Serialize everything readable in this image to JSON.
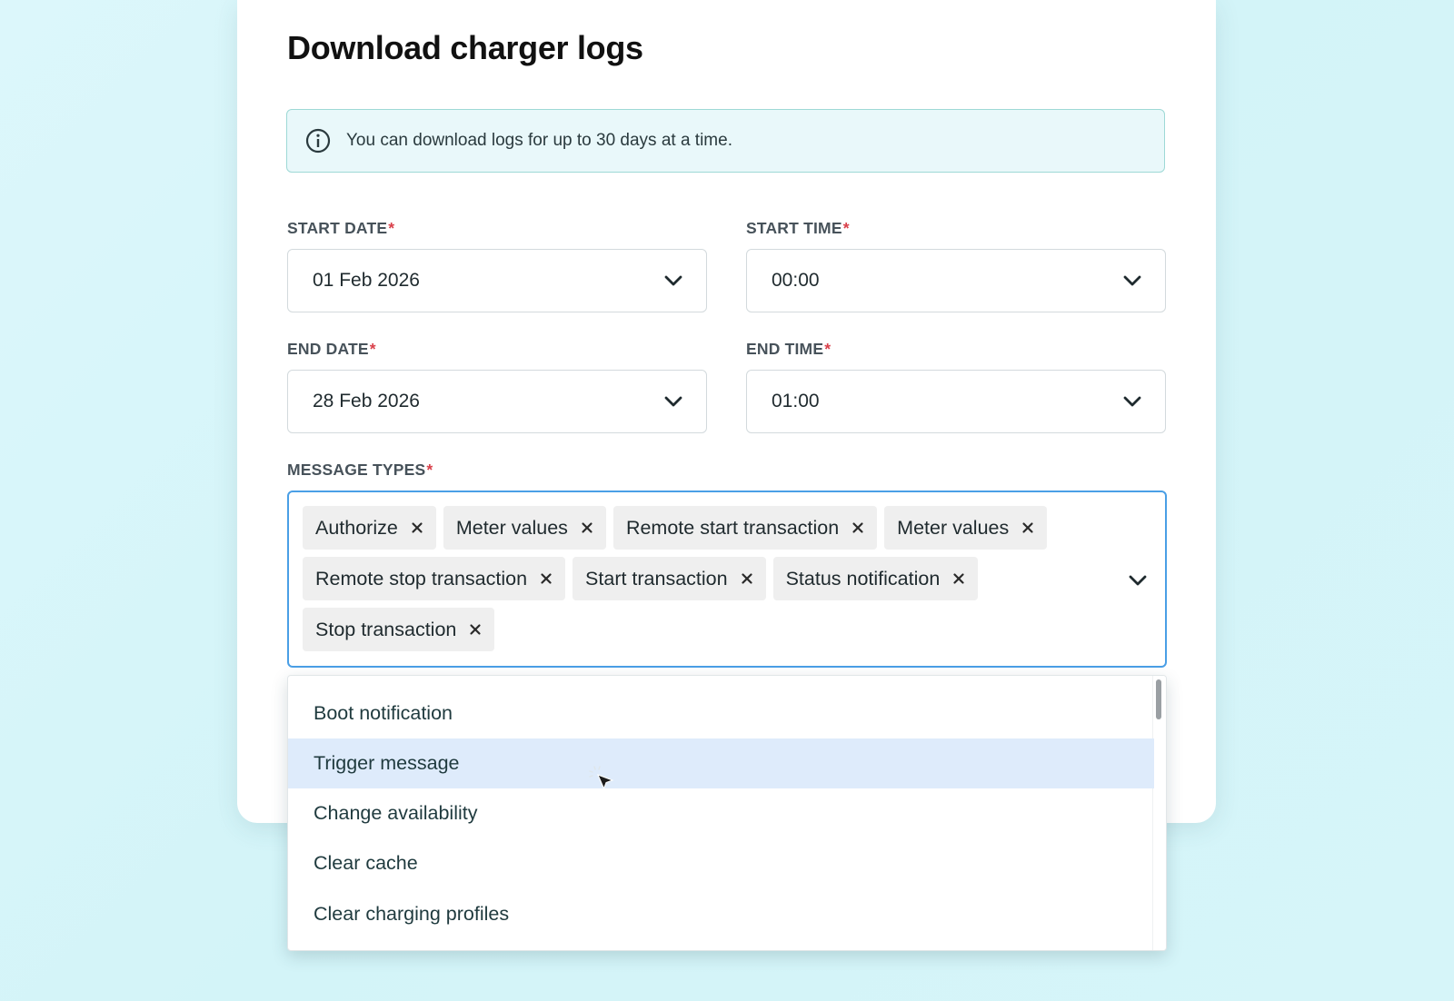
{
  "dialog": {
    "title": "Download charger logs",
    "info": "You can download logs for up to 30 days at a time.",
    "required_marker": "*"
  },
  "start_date": {
    "label": "START DATE",
    "value": "01 Feb 2026"
  },
  "start_time": {
    "label": "START TIME",
    "value": "00:00"
  },
  "end_date": {
    "label": "END DATE",
    "value": "28 Feb 2026"
  },
  "end_time": {
    "label": "END TIME",
    "value": "01:00"
  },
  "message_types": {
    "label": "MESSAGE TYPES",
    "selected": [
      "Authorize",
      "Meter values",
      "Remote start transaction",
      "Meter values",
      "Remote stop transaction",
      "Start transaction",
      "Status notification",
      "Stop transaction"
    ],
    "options": [
      "Boot notification",
      "Trigger message",
      "Change availability",
      "Clear cache",
      "Clear charging profiles"
    ],
    "hovered_option": "Trigger message"
  },
  "icons": {
    "info": "info-icon",
    "chevron": "chevron-down-icon",
    "remove": "close-icon",
    "cursor": "mouse-pointer-icon"
  },
  "colors": {
    "focus_border": "#4a9fe6",
    "info_border": "#9ed9d6",
    "info_background": "#e9f8fa",
    "required": "#d9404a",
    "hover_option": "#deebfb",
    "chip_background": "#efefef"
  }
}
